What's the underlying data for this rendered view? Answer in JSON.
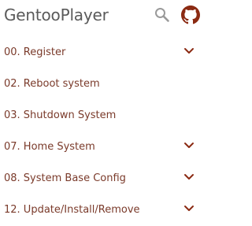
{
  "app": {
    "title": "GentooPlayer"
  },
  "colors": {
    "title": "#5a5a5a",
    "menu_text": "#7a3a2a",
    "icon_accent": "#8b2a12",
    "search_icon": "#9a9a9a"
  },
  "header": {
    "search_icon": "search-icon",
    "github_icon": "github-icon"
  },
  "menu": {
    "items": [
      {
        "label": "00. Register",
        "expandable": true
      },
      {
        "label": "02. Reboot system",
        "expandable": false
      },
      {
        "label": "03. Shutdown System",
        "expandable": false
      },
      {
        "label": "07. Home System",
        "expandable": true
      },
      {
        "label": "08. System Base Config",
        "expandable": true
      },
      {
        "label": "12. Update/Install/Remove",
        "expandable": true
      }
    ]
  }
}
